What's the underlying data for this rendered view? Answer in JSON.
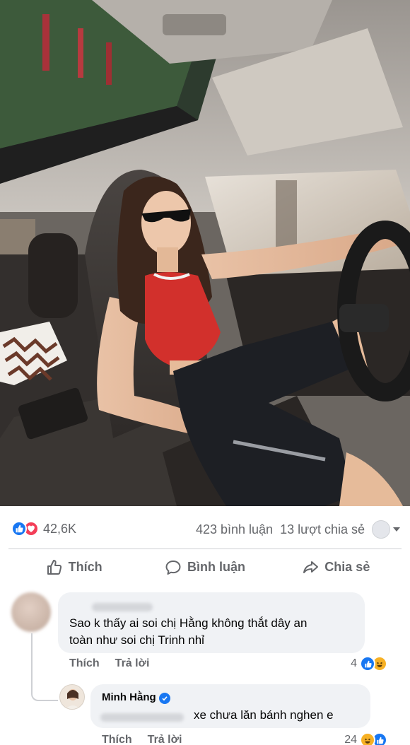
{
  "post": {
    "photo_icon": "car-interior-photo",
    "reactions": {
      "icons": [
        "like-icon",
        "love-icon"
      ],
      "count": "42,6K"
    },
    "comments_count": "423 bình luận",
    "shares_count": "13 lượt chia sẻ"
  },
  "actions": {
    "like": "Thích",
    "comment": "Bình luận",
    "share": "Chia sẻ"
  },
  "comments": [
    {
      "author": "",
      "text_line1": "Sao k thấy ai soi chị Hằng không thắt dây an",
      "text_line2": "toàn như soi chị Trinh nhỉ",
      "like_label": "Thích",
      "reply_label": "Trả lời",
      "reaction_count": "4"
    }
  ],
  "reply": {
    "author": "Minh Hằng",
    "text": "xe chưa lăn bánh nghen e",
    "like_label": "Thích",
    "reply_label": "Trả lời",
    "reaction_count": "24"
  },
  "colors": {
    "facebook_blue": "#1877f2",
    "love_red": "#f33e58",
    "haha_yellow": "#f7b125",
    "secondary_text": "#65676b",
    "bubble_bg": "#f0f2f5"
  }
}
